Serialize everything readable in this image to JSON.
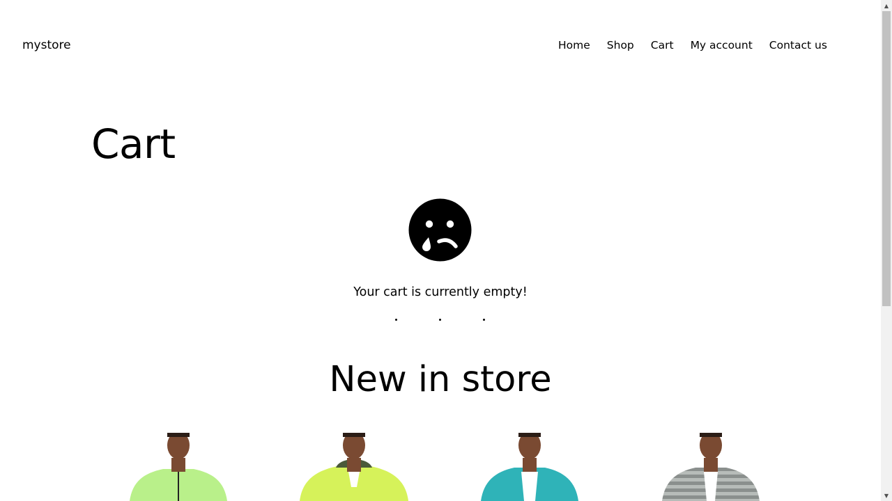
{
  "header": {
    "site_title": "mystore",
    "nav": [
      "Home",
      "Shop",
      "Cart",
      "My account",
      "Contact us"
    ]
  },
  "page": {
    "title": "Cart",
    "empty_icon": "crying-face-icon",
    "empty_message": "Your cart is currently empty!"
  },
  "new_in_store": {
    "title": "New in store",
    "products": [
      {
        "image": "product-image",
        "color": "#b9f08a"
      },
      {
        "image": "product-image",
        "color": "#d6f25a"
      },
      {
        "image": "product-image",
        "color": "#2fb3b8"
      },
      {
        "image": "product-image",
        "color": "#8a8f8d"
      }
    ]
  },
  "colors": {
    "text": "#000000",
    "background": "#ffffff"
  }
}
